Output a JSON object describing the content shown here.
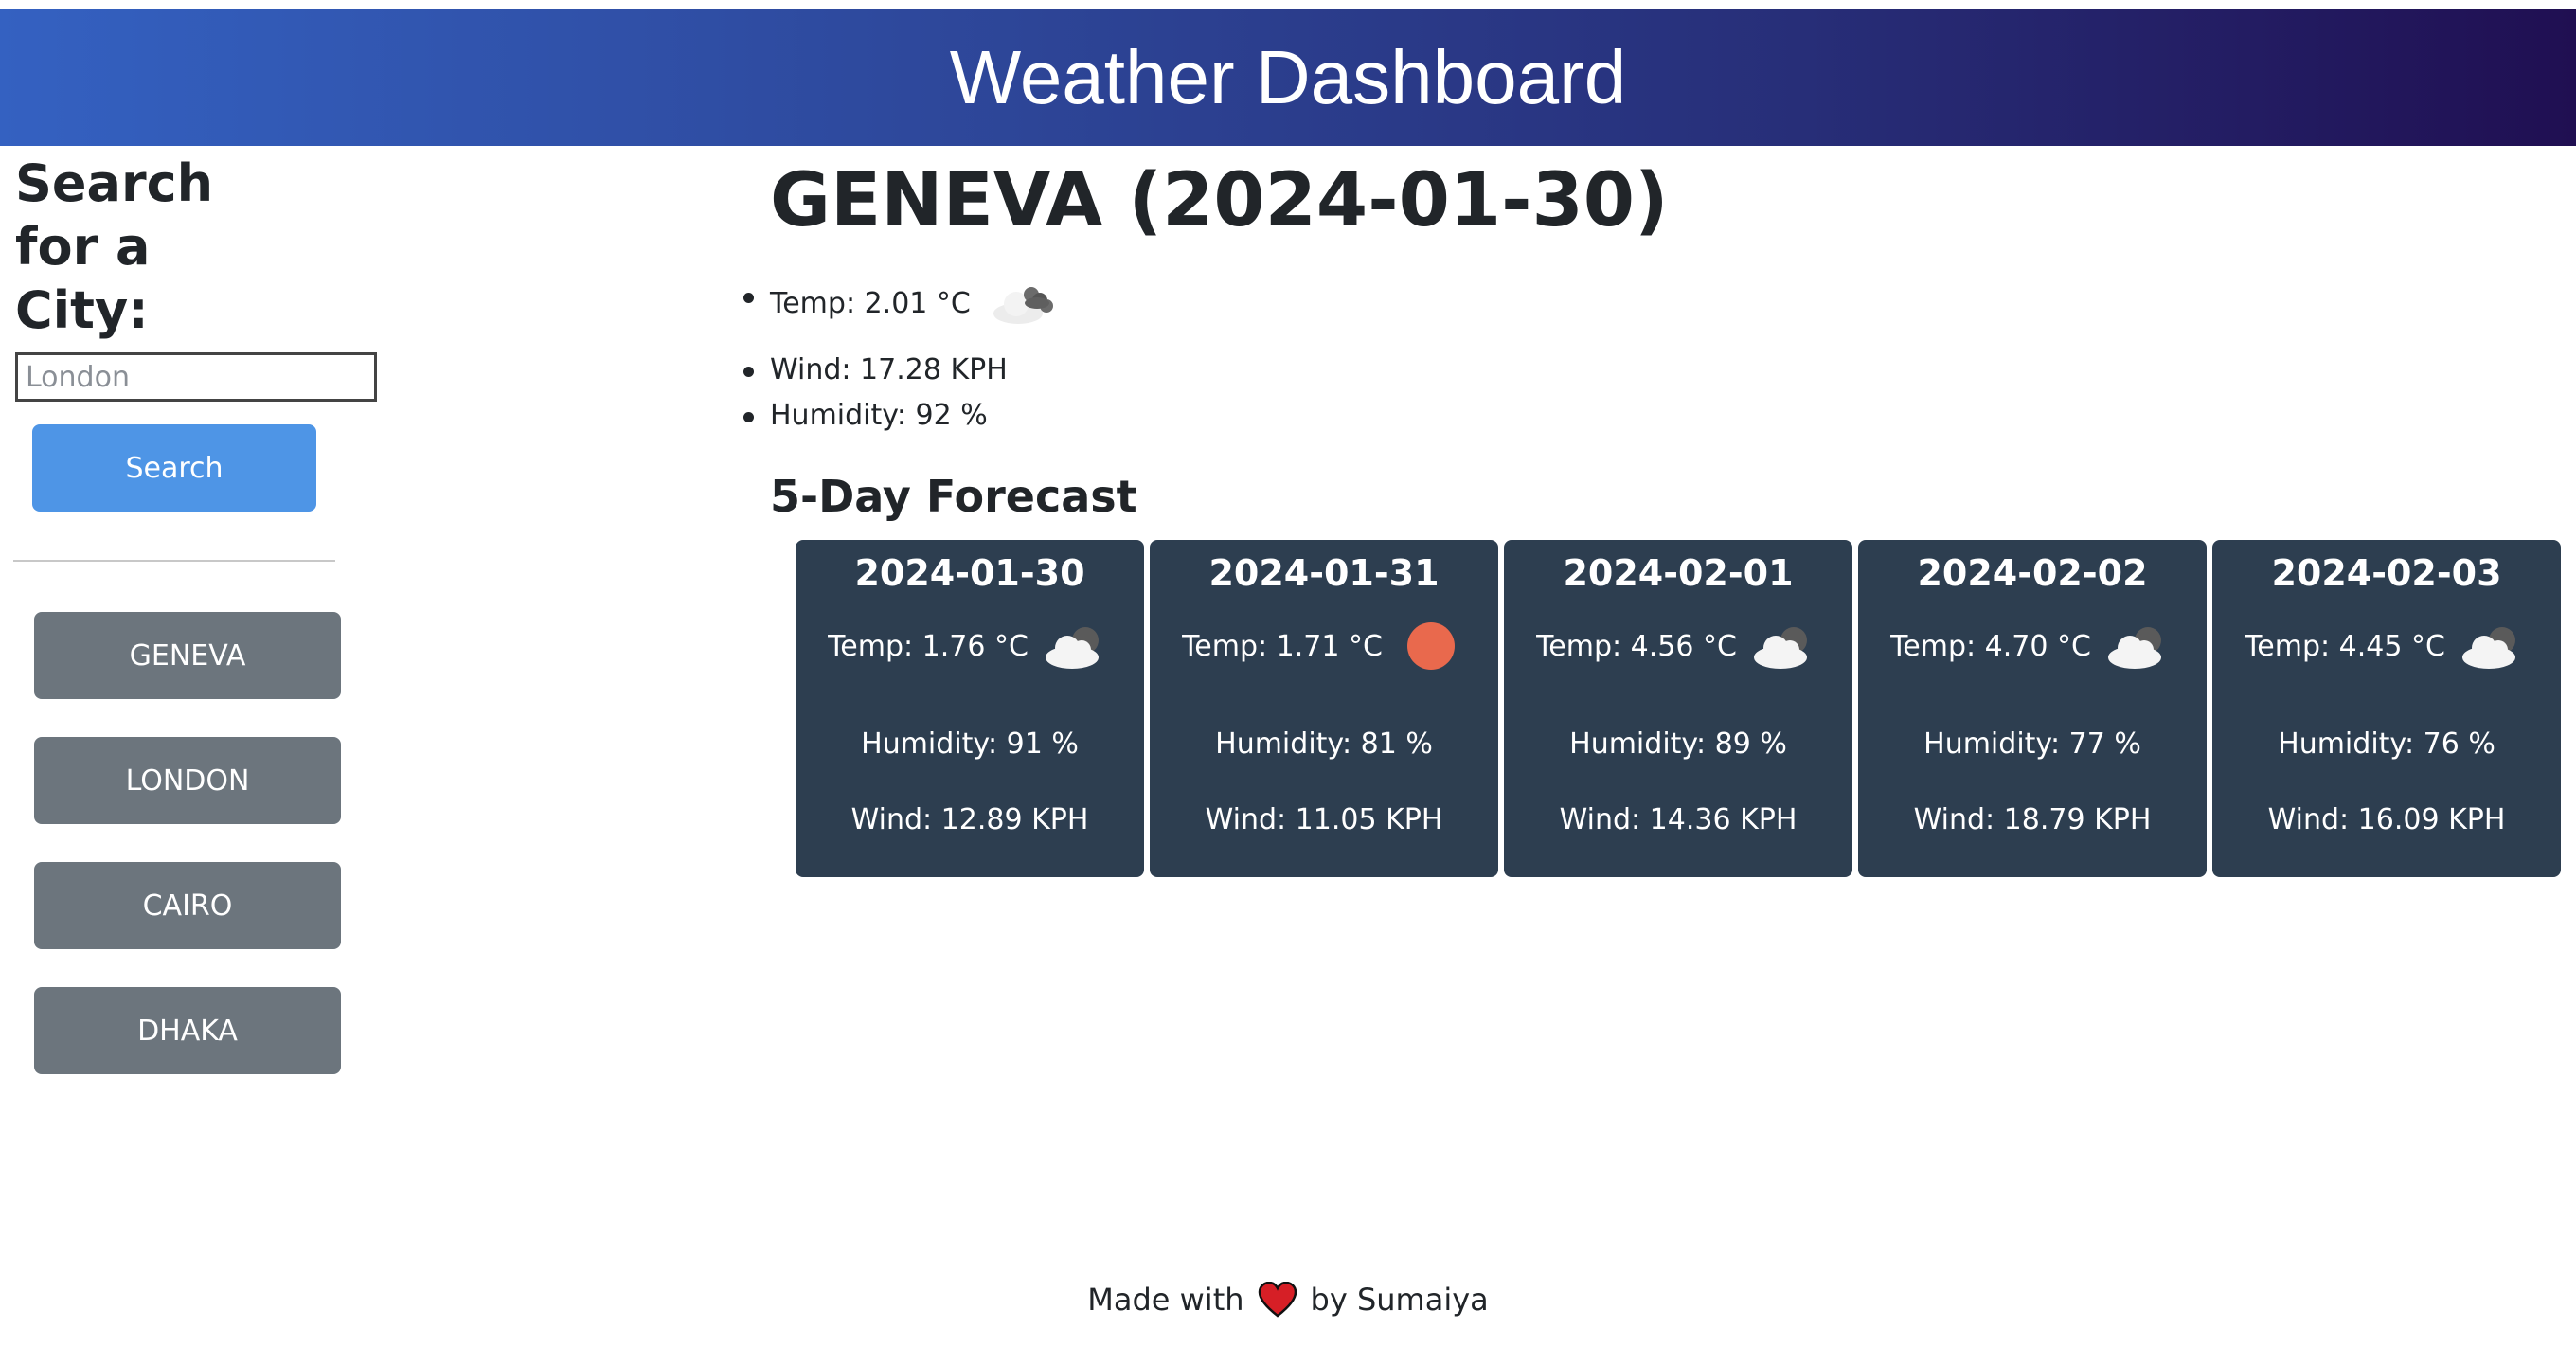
{
  "header": {
    "title": "Weather Dashboard"
  },
  "sidebar": {
    "search_title": "Search for a City:",
    "search_placeholder": "London",
    "search_button": "Search",
    "history": [
      "GENEVA",
      "LONDON",
      "CAIRO",
      "DHAKA"
    ]
  },
  "current": {
    "title": "GENEVA (2024-01-30)",
    "temp": "Temp: 2.01 °C",
    "icon": "cloudy-night-icon",
    "wind": "Wind: 17.28 KPH",
    "humidity": "Humidity: 92 %"
  },
  "forecast": {
    "title": "5-Day Forecast",
    "days": [
      {
        "date": "2024-01-30",
        "temp": "Temp: 1.76 °C",
        "icon": "cloud-icon",
        "humidity": "Humidity: 91 %",
        "wind": "Wind: 12.89 KPH"
      },
      {
        "date": "2024-01-31",
        "temp": "Temp: 1.71 °C",
        "icon": "sun-icon",
        "humidity": "Humidity: 81 %",
        "wind": "Wind: 11.05 KPH"
      },
      {
        "date": "2024-02-01",
        "temp": "Temp: 4.56 °C",
        "icon": "cloud-icon",
        "humidity": "Humidity: 89 %",
        "wind": "Wind: 14.36 KPH"
      },
      {
        "date": "2024-02-02",
        "temp": "Temp: 4.70 °C",
        "icon": "cloud-icon",
        "humidity": "Humidity: 77 %",
        "wind": "Wind: 18.79 KPH"
      },
      {
        "date": "2024-02-03",
        "temp": "Temp: 4.45 °C",
        "icon": "cloud-icon",
        "humidity": "Humidity: 76 %",
        "wind": "Wind: 16.09 KPH"
      }
    ]
  },
  "footer": {
    "prefix": "Made with",
    "icon": "heart-icon",
    "suffix": "by Sumaiya"
  },
  "colors": {
    "header_start": "#3461c1",
    "header_end": "#200f52",
    "search_button": "#4e95e6",
    "city_button": "#6c757d",
    "card_bg": "#2d3e50",
    "sun": "#e9694d",
    "heart": "#d61f26"
  }
}
